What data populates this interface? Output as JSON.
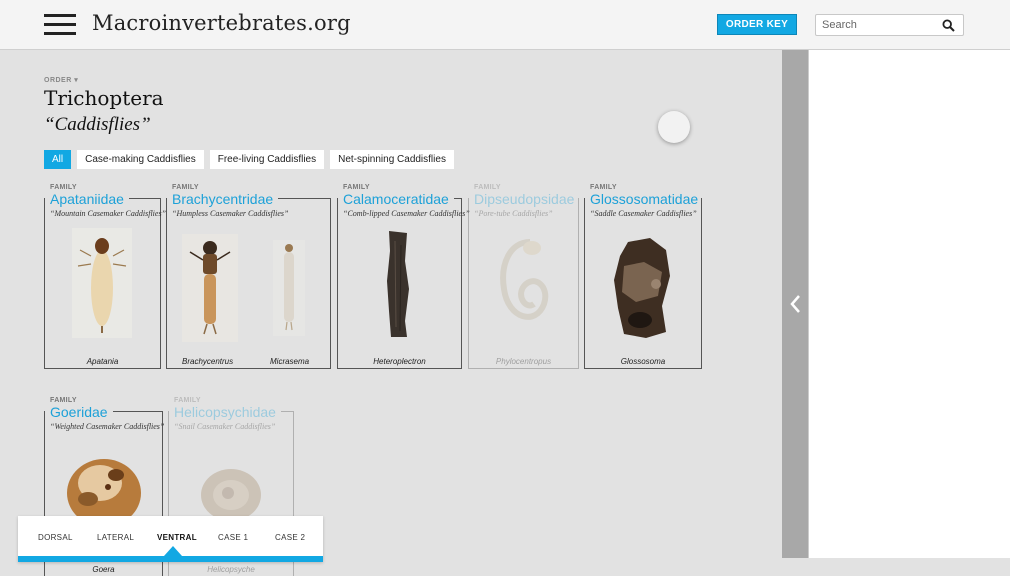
{
  "header": {
    "site_title": "Macroinvertebrates.org",
    "order_key_label": "ORDER KEY",
    "search_placeholder": "Search"
  },
  "order": {
    "label": "ORDER ▾",
    "name": "Trichoptera",
    "common_name": "“Caddisflies”"
  },
  "filters": [
    "All",
    "Case-making Caddisflies",
    "Free-living Caddisflies",
    "Net-spinning Caddisflies"
  ],
  "families": [
    {
      "label": "FAMILY",
      "name": "Apataniidae",
      "common": "“Mountain Casemaker Caddisflies”",
      "genera": [
        "Apatania"
      ]
    },
    {
      "label": "FAMILY",
      "name": "Brachycentridae",
      "common": "“Humpless Casemaker Caddisflies”",
      "genera": [
        "Brachycentrus",
        "Micrasema"
      ]
    },
    {
      "label": "FAMILY",
      "name": "Calamoceratidae",
      "common": "“Comb-lipped Casemaker Caddisflies”",
      "genera": [
        "Heteroplectron"
      ]
    },
    {
      "label": "FAMILY",
      "name": "Dipseudopsidae",
      "common": "“Pore-tube Caddisflies”",
      "genera": [
        "Phylocentropus"
      ]
    },
    {
      "label": "FAMILY",
      "name": "Glossosomatidae",
      "common": "“Saddle Casemaker Caddisflies”",
      "genera": [
        "Glossosoma"
      ]
    },
    {
      "label": "FAMILY",
      "name": "Goeridae",
      "common": "“Weighted Casemaker Caddisflies”",
      "genera": [
        "Goera"
      ]
    },
    {
      "label": "FAMILY",
      "name": "Helicopsychidae",
      "common": "“Snail Casemaker Caddisflies”",
      "genera": [
        "Helicopsyche"
      ]
    }
  ],
  "view_tabs": [
    "DORSAL",
    "LATERAL",
    "VENTRAL",
    "CASE 1",
    "CASE 2"
  ],
  "colors": {
    "accent": "#12a8e3",
    "family_name": "#1da1d8"
  }
}
